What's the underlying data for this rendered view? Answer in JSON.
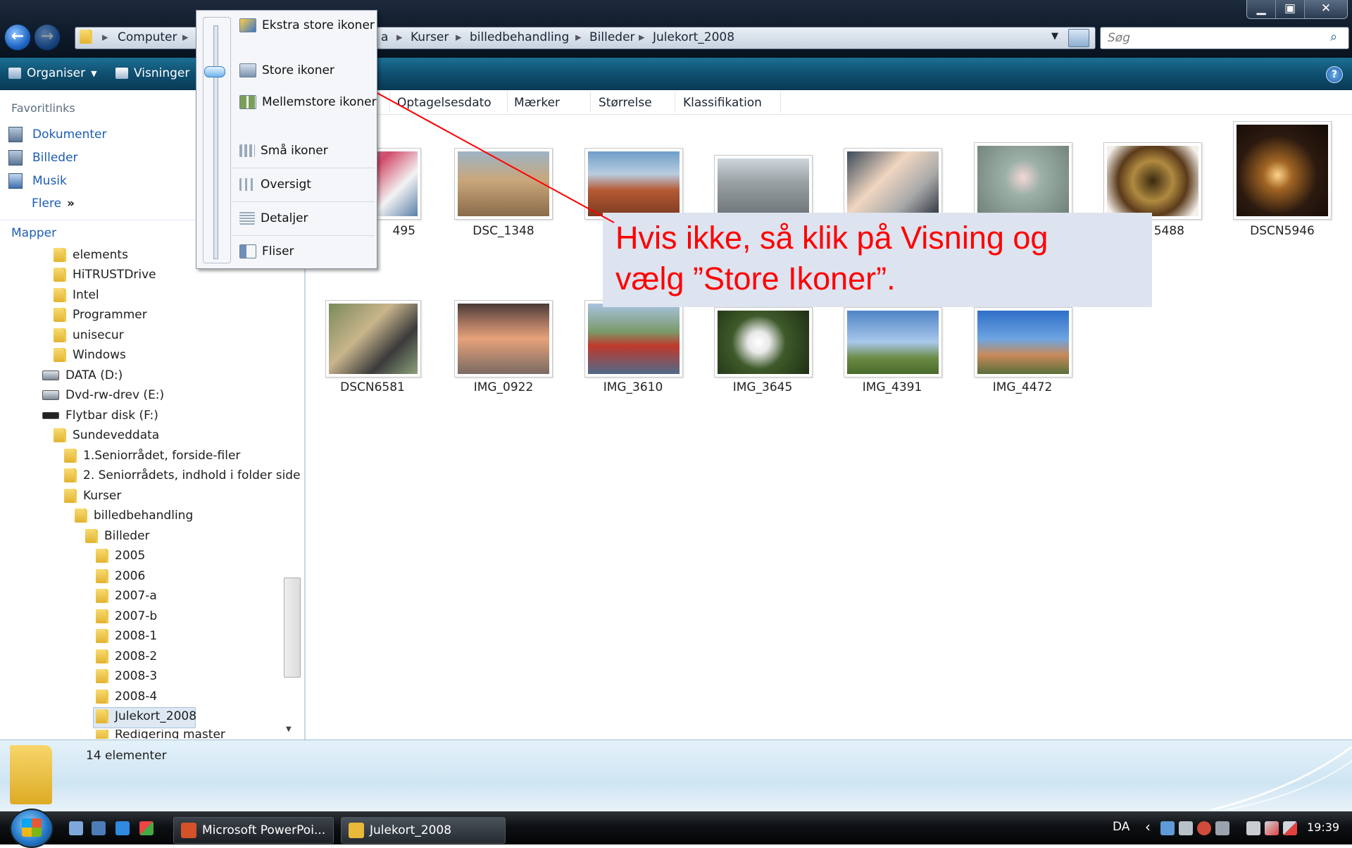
{
  "window": {
    "min_glyph": "▁",
    "max_glyph": "▣",
    "close_glyph": "✕"
  },
  "address": {
    "segments": [
      "Computer",
      "a",
      "Kurser",
      "billedbehandling",
      "Billeder",
      "Julekort_2008"
    ],
    "separator": "▸"
  },
  "search": {
    "placeholder": "Søg"
  },
  "toolbar": {
    "organize": "Organiser",
    "views": "Visninger",
    "help": "?"
  },
  "favorites": {
    "heading": "Favoritlinks",
    "items": [
      "Dokumenter",
      "Billeder",
      "Musik"
    ],
    "more": "Flere",
    "more_glyph": "»"
  },
  "folders": {
    "heading": "Mapper",
    "items": [
      "elements",
      "HiTRUSTDrive",
      "Intel",
      "Programmer",
      "unisecur",
      "Windows",
      "DATA (D:)",
      "Dvd-rw-drev (E:)",
      "Flytbar disk (F:)",
      "Sundeveddata",
      "1.Seniorrådet, forside-filer",
      "2. Seniorrådets, indhold i folder side",
      "Kurser",
      "billedbehandling",
      "Billeder",
      "2005",
      "2006",
      "2007-a",
      "2007-b",
      "2008-1",
      "2008-2",
      "2008-3",
      "2008-4",
      "Julekort_2008",
      "Redigering master"
    ],
    "selected": "Julekort_2008"
  },
  "columns": [
    "Optagelsesdato",
    "Mærker",
    "Størrelse",
    "Klassifikation"
  ],
  "files": [
    "495",
    "DSC_1348",
    "5488",
    "DSCN5946",
    "DSCN6581",
    "IMG_0922",
    "IMG_3610",
    "IMG_3645",
    "IMG_4391",
    "IMG_4472"
  ],
  "views_menu": {
    "items": [
      "Ekstra store ikoner",
      "Store ikoner",
      "Mellemstore ikoner",
      "Små ikoner",
      "Oversigt",
      "Detaljer",
      "Fliser"
    ],
    "selected": "Store ikoner"
  },
  "callout": {
    "line1": "Hvis ikke, så klik på Visning og",
    "line2": "vælg ”Store Ikoner”.",
    "text_color": "#ff0000"
  },
  "status": {
    "count": "14 elementer"
  },
  "taskbar": {
    "tasks": [
      "Microsoft PowerPoi...",
      "Julekort_2008"
    ],
    "language": "DA",
    "tray_arrow": "‹",
    "clock": "19:39"
  },
  "colors": {
    "titlebar": "#0e1a29",
    "toolbar": "#0f4f70",
    "link": "#1c5db5",
    "accent_arrow": "#ff0000"
  }
}
